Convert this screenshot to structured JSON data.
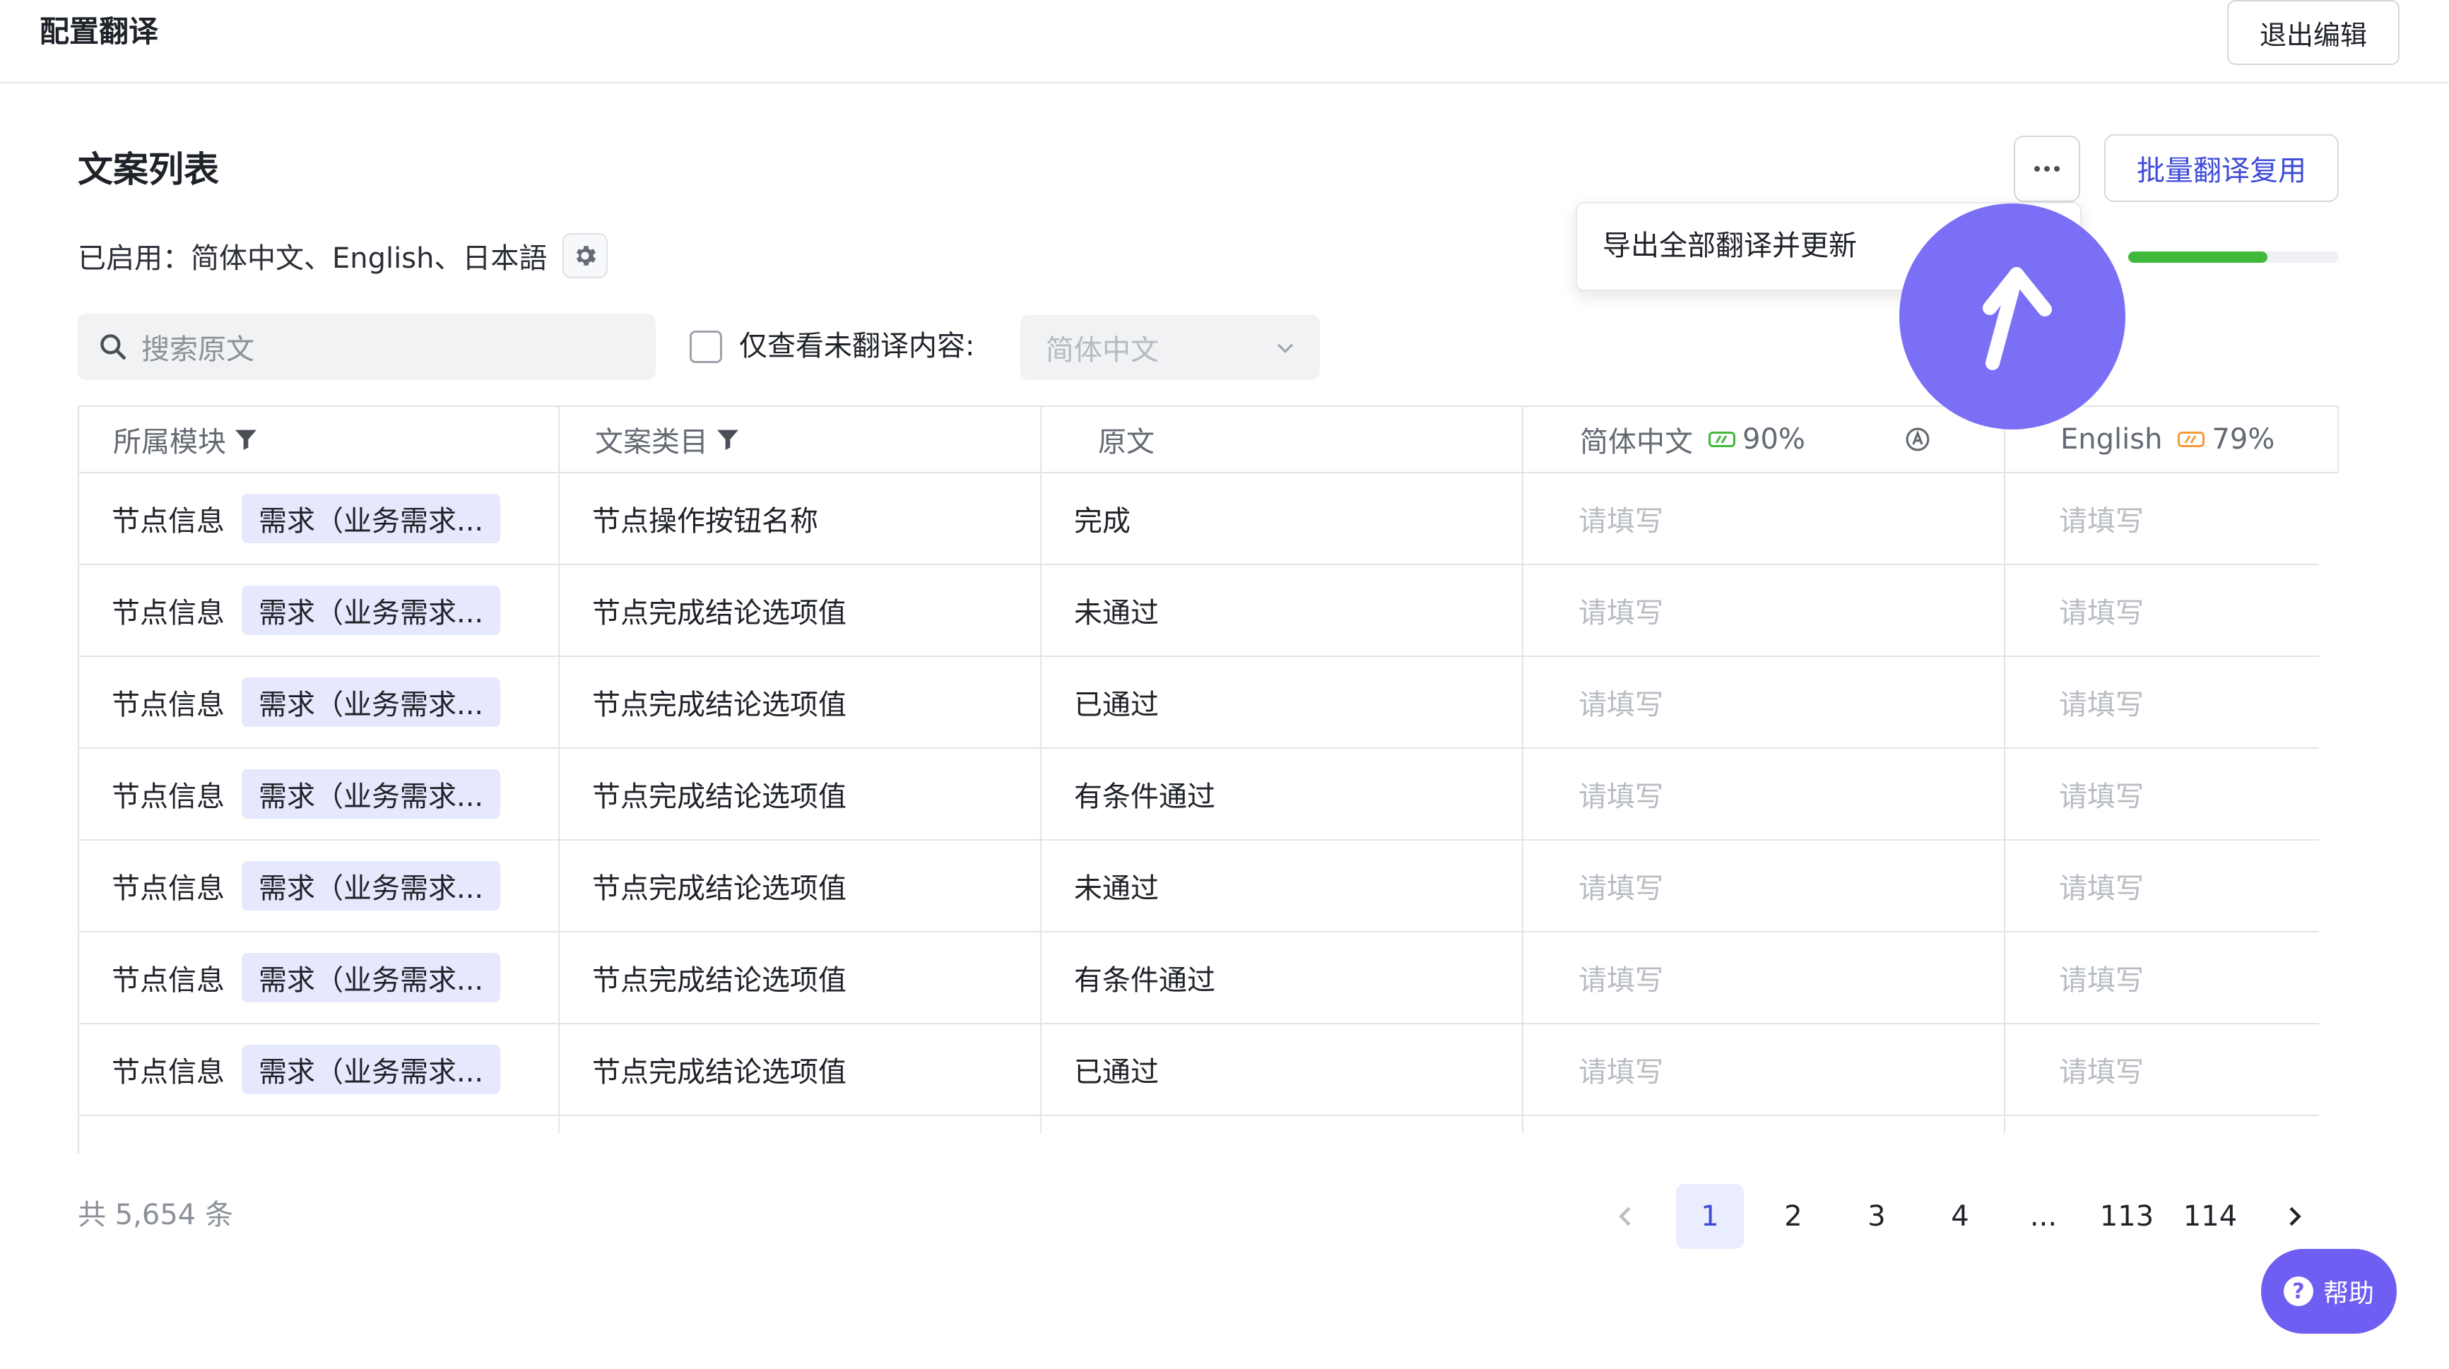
{
  "header": {
    "title": "配置翻译",
    "exit_label": "退出编辑"
  },
  "section": {
    "title": "文案列表",
    "batch_button": "批量翻译复用",
    "enabled_prefix": "已启用：",
    "enabled_languages": "简体中文、English、日本語",
    "progress": 0.66
  },
  "dropdown": {
    "item": "导出全部翻译并更新"
  },
  "filters": {
    "search_placeholder": "搜索原文",
    "untranslated_label": "仅查看未翻译内容:",
    "untranslated_checked": false,
    "language_select": "简体中文"
  },
  "table": {
    "headers": {
      "module": "所属模块",
      "category": "文案类目",
      "original": "原文",
      "zh": "简体中文",
      "zh_pct": "90%",
      "en": "English",
      "en_pct": "79%"
    },
    "rows": [
      {
        "module": "节点信息",
        "tag": "需求（业务需求...",
        "category": "节点操作按钮名称",
        "original": "完成",
        "zh": "请填写",
        "en": "请填写"
      },
      {
        "module": "节点信息",
        "tag": "需求（业务需求...",
        "category": "节点完成结论选项值",
        "original": "未通过",
        "zh": "请填写",
        "en": "请填写"
      },
      {
        "module": "节点信息",
        "tag": "需求（业务需求...",
        "category": "节点完成结论选项值",
        "original": "已通过",
        "zh": "请填写",
        "en": "请填写"
      },
      {
        "module": "节点信息",
        "tag": "需求（业务需求...",
        "category": "节点完成结论选项值",
        "original": "有条件通过",
        "zh": "请填写",
        "en": "请填写"
      },
      {
        "module": "节点信息",
        "tag": "需求（业务需求...",
        "category": "节点完成结论选项值",
        "original": "未通过",
        "zh": "请填写",
        "en": "请填写"
      },
      {
        "module": "节点信息",
        "tag": "需求（业务需求...",
        "category": "节点完成结论选项值",
        "original": "有条件通过",
        "zh": "请填写",
        "en": "请填写"
      },
      {
        "module": "节点信息",
        "tag": "需求（业务需求...",
        "category": "节点完成结论选项值",
        "original": "已通过",
        "zh": "请填写",
        "en": "请填写"
      }
    ]
  },
  "footer": {
    "total": "共 5,654 条",
    "pages": [
      "1",
      "2",
      "3",
      "4",
      "...",
      "113",
      "114"
    ],
    "current_page": "1"
  },
  "help": {
    "label": "帮助"
  },
  "colors": {
    "accent": "#3d4bd8",
    "overlay_circle": "#7b6ff6",
    "help_button": "#6e5ef2",
    "progress": "#3fb83b",
    "zh_badge": "#3fb83b",
    "en_badge": "#f39a3b"
  }
}
